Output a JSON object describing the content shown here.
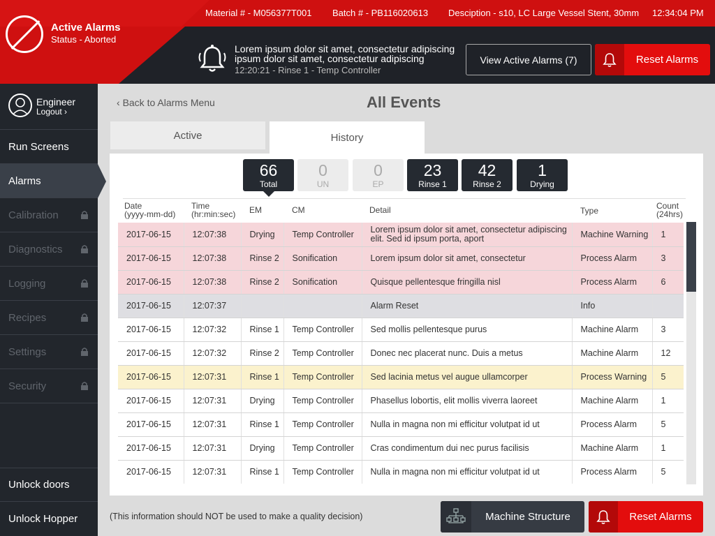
{
  "header": {
    "title": "Active Alarms",
    "status": "Status - Aborted",
    "material": "Material # - M056377T001",
    "batch": "Batch # - PB116020613",
    "description": "Desciption - s10, LC Large Vessel Stent, 30mm",
    "time": "12:34:04 PM",
    "message": "Lorem ipsum dolor sit amet, consectetur adipiscing ipsum dolor sit amet, consectetur adipiscing",
    "message_sub": "12:20:21 - Rinse 1 - Temp Controller",
    "view_button": "View Active Alarms (7)",
    "reset_button": "Reset Alarms",
    "accent_color": "#e30d0d"
  },
  "sidebar": {
    "user_name": "Engineer",
    "logout": "Logout",
    "items": [
      {
        "label": "Run Screens",
        "state": "enabled"
      },
      {
        "label": "Alarms",
        "state": "active"
      },
      {
        "label": "Calibration",
        "state": "locked"
      },
      {
        "label": "Diagnostics",
        "state": "locked"
      },
      {
        "label": "Logging",
        "state": "locked"
      },
      {
        "label": "Recipes",
        "state": "locked"
      },
      {
        "label": "Settings",
        "state": "locked"
      },
      {
        "label": "Security",
        "state": "locked"
      }
    ],
    "bottom_items": [
      "Unlock doors",
      "Unlock Hopper"
    ]
  },
  "main": {
    "back_link": "Back to Alarms Menu",
    "title": "All Events",
    "tabs": [
      "Active",
      "History"
    ],
    "selected_tab": "History",
    "counters": [
      {
        "value": "66",
        "label": "Total",
        "style": "dark"
      },
      {
        "value": "0",
        "label": "UN",
        "style": "light"
      },
      {
        "value": "0",
        "label": "EP",
        "style": "light"
      },
      {
        "value": "23",
        "label": "Rinse 1",
        "style": "dark"
      },
      {
        "value": "42",
        "label": "Rinse 2",
        "style": "dark"
      },
      {
        "value": "1",
        "label": "Drying",
        "style": "dark"
      }
    ],
    "columns": {
      "date": "Date",
      "date_sub": "(yyyy-mm-dd)",
      "time": "Time",
      "time_sub": "(hr:min:sec)",
      "em": "EM",
      "cm": "CM",
      "detail": "Detail",
      "type": "Type",
      "count": "Count",
      "count_sub": "(24hrs)"
    },
    "rows": [
      {
        "date": "2017-06-15",
        "time": "12:07:38",
        "em": "Drying",
        "cm": "Temp Controller",
        "detail": "Lorem ipsum dolor sit amet, consectetur adipiscing elit. Sed id ipsum porta, aport",
        "type": "Machine Warning",
        "count": "1",
        "style": "warn"
      },
      {
        "date": "2017-06-15",
        "time": "12:07:38",
        "em": "Rinse 2",
        "cm": "Sonification",
        "detail": "Lorem ipsum dolor sit amet, consectetur",
        "type": "Process Alarm",
        "count": "3",
        "style": "warn"
      },
      {
        "date": "2017-06-15",
        "time": "12:07:38",
        "em": "Rinse 2",
        "cm": "Sonification",
        "detail": "Quisque pellentesque fringilla nisl",
        "type": "Process Alarm",
        "count": "6",
        "style": "warn"
      },
      {
        "date": "2017-06-15",
        "time": "12:07:37",
        "em": "",
        "cm": "",
        "detail": "Alarm Reset",
        "type": "Info",
        "count": "",
        "style": "info"
      },
      {
        "date": "2017-06-15",
        "time": "12:07:32",
        "em": "Rinse 1",
        "cm": "Temp Controller",
        "detail": "Sed mollis pellentesque purus",
        "type": "Machine Alarm",
        "count": "3",
        "style": ""
      },
      {
        "date": "2017-06-15",
        "time": "12:07:32",
        "em": "Rinse 2",
        "cm": "Temp Controller",
        "detail": "Donec nec placerat nunc. Duis a metus",
        "type": "Machine Alarm",
        "count": "12",
        "style": ""
      },
      {
        "date": "2017-06-15",
        "time": "12:07:31",
        "em": "Rinse 1",
        "cm": "Temp Controller",
        "detail": "Sed lacinia metus vel augue ullamcorper",
        "type": "Process Warning",
        "count": "5",
        "style": "proc"
      },
      {
        "date": "2017-06-15",
        "time": "12:07:31",
        "em": "Drying",
        "cm": "Temp Controller",
        "detail": "Phasellus lobortis, elit mollis viverra laoreet",
        "type": "Machine Alarm",
        "count": "1",
        "style": ""
      },
      {
        "date": "2017-06-15",
        "time": "12:07:31",
        "em": "Rinse 1",
        "cm": "Temp Controller",
        "detail": "Nulla in magna non mi efficitur volutpat id ut",
        "type": "Process Alarm",
        "count": "5",
        "style": ""
      },
      {
        "date": "2017-06-15",
        "time": "12:07:31",
        "em": "Drying",
        "cm": "Temp Controller",
        "detail": "Cras condimentum dui nec purus facilisis",
        "type": "Machine Alarm",
        "count": "1",
        "style": ""
      },
      {
        "date": "2017-06-15",
        "time": "12:07:31",
        "em": "Rinse 1",
        "cm": "Temp Controller",
        "detail": "Nulla in magna non mi efficitur volutpat id ut",
        "type": "Process Alarm",
        "count": "5",
        "style": ""
      }
    ]
  },
  "footer": {
    "note": "(This information should NOT be used to make a quality decision)",
    "machine_structure": "Machine Structure",
    "reset_button": "Reset Alarms"
  }
}
